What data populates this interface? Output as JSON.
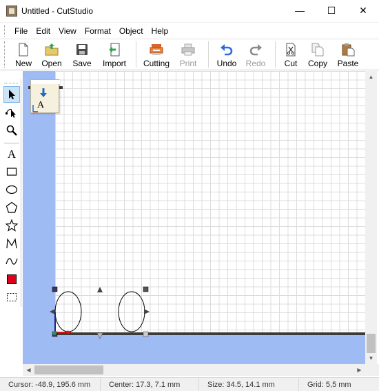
{
  "window": {
    "title": "Untitled - CutStudio",
    "minimize": "—",
    "maximize": "☐",
    "close": "✕"
  },
  "menu": [
    "File",
    "Edit",
    "View",
    "Format",
    "Object",
    "Help"
  ],
  "toolbar": {
    "new": "New",
    "open": "Open",
    "save": "Save",
    "import": "Import",
    "cutting": "Cutting",
    "print": "Print",
    "undo": "Undo",
    "redo": "Redo",
    "cut": "Cut",
    "copy": "Copy",
    "paste": "Paste"
  },
  "left_tools": [
    {
      "name": "select-tool-icon",
      "active": true
    },
    {
      "name": "node-edit-tool-icon",
      "active": false
    },
    {
      "name": "zoom-tool-icon",
      "active": false
    },
    {
      "name": "text-tool-icon",
      "active": false
    },
    {
      "name": "rectangle-tool-icon",
      "active": false
    },
    {
      "name": "ellipse-tool-icon",
      "active": false
    },
    {
      "name": "polygon-tool-icon",
      "active": false
    },
    {
      "name": "star-tool-icon",
      "active": false
    },
    {
      "name": "polyline-tool-icon",
      "active": false
    },
    {
      "name": "curve-tool-icon",
      "active": false
    },
    {
      "name": "color-fill-icon",
      "active": false
    },
    {
      "name": "selection-frame-icon",
      "active": false
    }
  ],
  "tool_text_glyph": "A",
  "card_glyph": "A",
  "colors": {
    "canvas_background": "#9fbbf4",
    "selected_tool": "#cce4f7",
    "fill_color": "#e0001b",
    "cut_line": "#3b3b3b",
    "undo_arrow": "#2f6bd8"
  },
  "status": {
    "cursor": "Cursor: -48.9, 195.6 mm",
    "center": "Center: 17.3, 7.1 mm",
    "size": "Size: 34.5, 14.1 mm",
    "grid": "Grid: 5,5 mm"
  }
}
